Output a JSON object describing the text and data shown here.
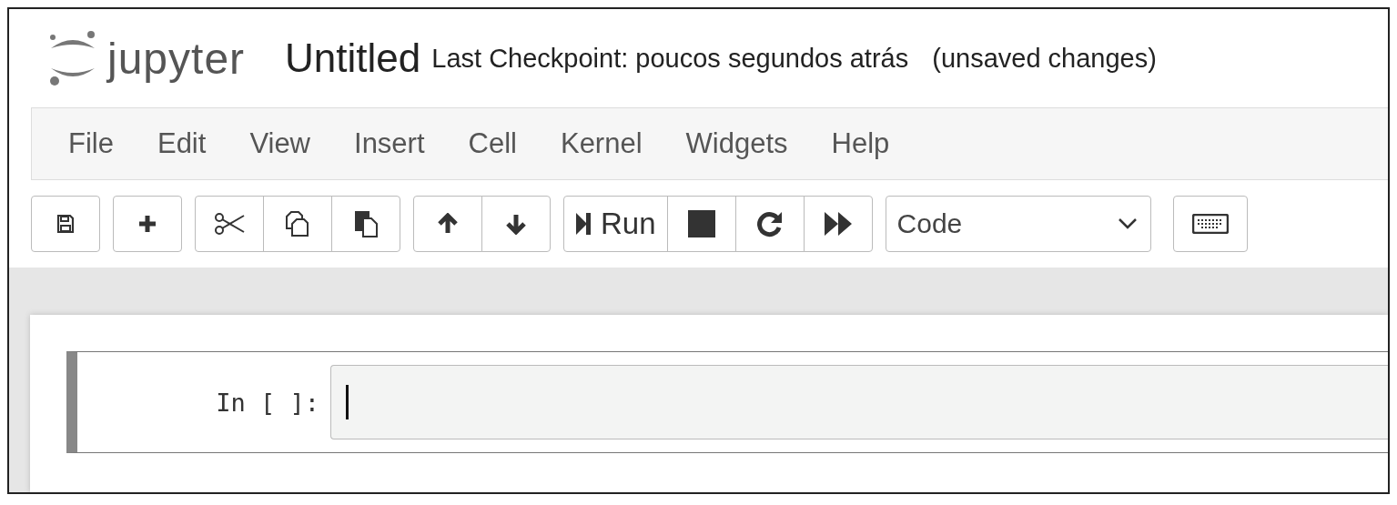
{
  "header": {
    "logo": "jupyter",
    "notebook_name": "Untitled",
    "checkpoint": "Last Checkpoint: poucos segundos atrás",
    "status": "(unsaved changes)"
  },
  "menu": [
    "File",
    "Edit",
    "View",
    "Insert",
    "Cell",
    "Kernel",
    "Widgets",
    "Help"
  ],
  "toolbar": [
    [
      {
        "kind": "save"
      }
    ],
    [
      {
        "kind": "add"
      }
    ],
    [
      {
        "kind": "cut"
      },
      {
        "kind": "copy"
      },
      {
        "kind": "paste"
      }
    ],
    [
      {
        "kind": "up"
      },
      {
        "kind": "down"
      }
    ],
    [
      {
        "kind": "run",
        "label": "Run"
      },
      {
        "kind": "stop"
      },
      {
        "kind": "restart"
      },
      {
        "kind": "fastforward"
      }
    ]
  ],
  "cell_type": "Code",
  "cells": [
    {
      "prompt": "In [ ]:",
      "selected": true
    }
  ]
}
